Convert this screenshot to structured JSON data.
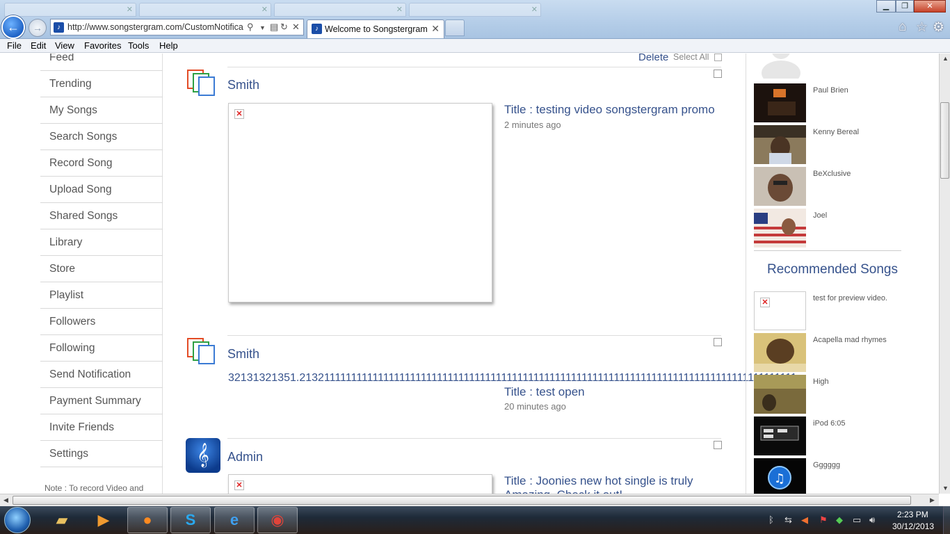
{
  "browser": {
    "ghost_tabs": [],
    "address_url": "http://www.songstergram.com/CustomNotifica",
    "active_tab_title": "Welcome to Songstergram",
    "menu": [
      "File",
      "Edit",
      "View",
      "Favorites",
      "Tools",
      "Help"
    ],
    "icons": {
      "back": "back-arrow-icon",
      "forward": "forward-arrow-icon",
      "home": "home-icon",
      "favorites": "star-icon",
      "tools": "gear-icon"
    }
  },
  "left_nav": {
    "items": [
      "Feed",
      "Trending",
      "My Songs",
      "Search Songs",
      "Record Song",
      "Upload Song",
      "Shared Songs",
      "Library",
      "Store",
      "Playlist",
      "Followers",
      "Following",
      "Send Notification",
      "Payment Summary",
      "Invite Friends",
      "Settings"
    ],
    "note": "Note : To record Video and"
  },
  "main": {
    "delete_label": "Delete",
    "select_all_label": "Select All",
    "posts": [
      {
        "author": "Smith",
        "title": "Title : testing video songstergram promo",
        "time": "2 minutes ago"
      },
      {
        "author": "Smith",
        "long_text": "32131321351.21321111111111111111111111111111111111111111111111111111111111111111111111111111111111111111",
        "title": "Title : test open",
        "time": "20 minutes ago"
      },
      {
        "author": "Admin",
        "title": "Title : Joonies new hot single is truly",
        "title_line2": "Amazing. Check it out!"
      }
    ]
  },
  "right_col": {
    "people": [
      "Paul Brien",
      "Kenny Bereal",
      "BeXclusive",
      "Joel"
    ],
    "recommended_heading": "Recommended Songs",
    "songs": [
      "test for preview video.",
      "Acapella mad rhymes",
      "High",
      "iPod 6:05",
      "Gggggg"
    ]
  },
  "taskbar": {
    "time": "2:23 PM",
    "date": "30/12/2013"
  },
  "colors": {
    "link": "#36528c",
    "nav_text": "#555555"
  }
}
